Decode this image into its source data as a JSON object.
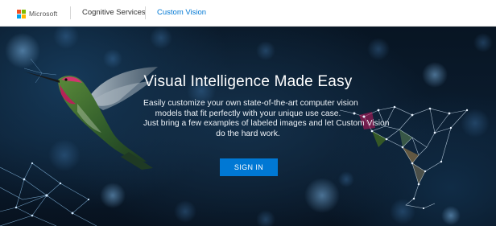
{
  "nav": {
    "brand": "Microsoft",
    "links": [
      {
        "label": "Cognitive Services"
      },
      {
        "label": "Custom Vision"
      }
    ]
  },
  "hero": {
    "title": "Visual Intelligence Made Easy",
    "description_lines": [
      "Easily customize your own state-of-the-art computer vision",
      "models that fit perfectly with your unique use case.",
      "Just bring a few examples of labeled images and let Custom Vision",
      "do the hard work."
    ],
    "cta_label": "SIGN IN"
  },
  "colors": {
    "accent": "#0078d4",
    "logo_red": "#f25022",
    "logo_green": "#7fba00",
    "logo_blue": "#00a4ef",
    "logo_yellow": "#ffb900",
    "hero_background": "#0b1d30"
  },
  "icons": [
    "microsoft-logo-icon"
  ]
}
